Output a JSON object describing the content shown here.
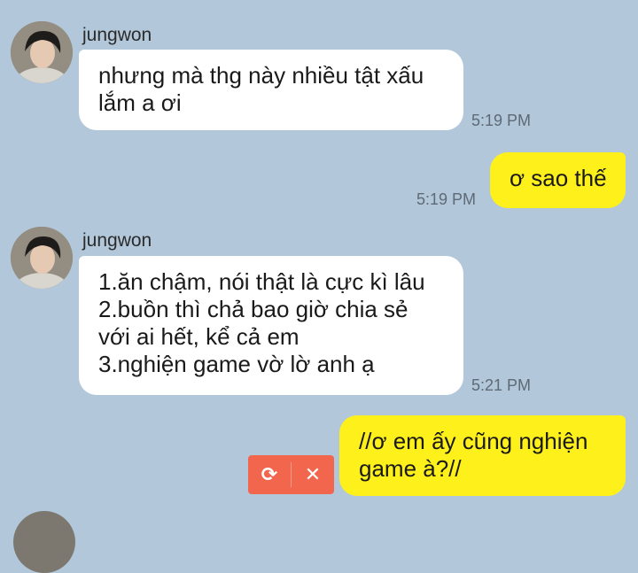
{
  "messages": [
    {
      "sender": "jungwon",
      "direction": "incoming",
      "lines": [
        "nhưng mà thg này nhiều tật xấu",
        "lắm a ơi"
      ],
      "time": "5:19 PM"
    },
    {
      "direction": "outgoing",
      "lines": [
        "ơ sao thế"
      ],
      "time": "5:19 PM"
    },
    {
      "sender": "jungwon",
      "direction": "incoming",
      "lines": [
        "1.ăn chậm, nói thật là cực kì lâu",
        "2.buồn thì chả bao giờ chia sẻ",
        "với ai hết, kể cả em",
        "3.nghiện game vờ lờ anh ạ"
      ],
      "time": "5:21 PM"
    },
    {
      "direction": "outgoing",
      "lines": [
        "//ơ em ấy cũng nghiện",
        "game à?//"
      ],
      "status": "failed"
    }
  ],
  "failed_actions": {
    "retry_icon": "retry-icon",
    "cancel_icon": "close-icon"
  },
  "colors": {
    "background": "#b2c7da",
    "incoming_bubble": "#ffffff",
    "outgoing_bubble": "#fef01b",
    "failed_action": "#f2664d"
  }
}
